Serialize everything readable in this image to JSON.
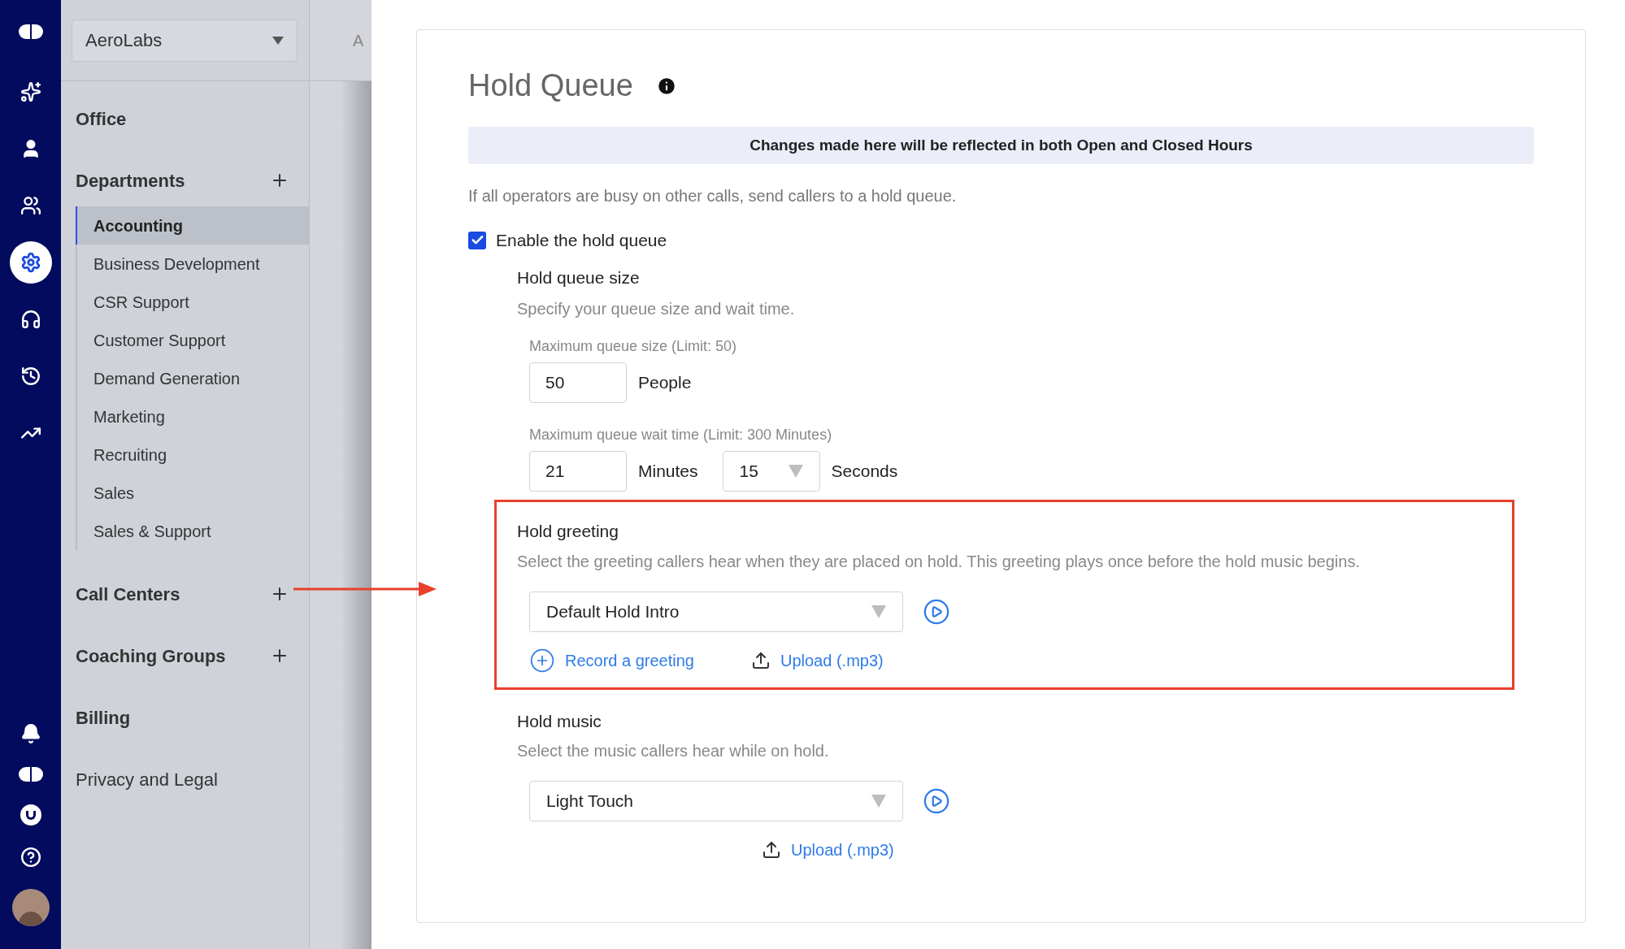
{
  "rail": {
    "top": [
      {
        "kind": "sparkle",
        "selected": false
      },
      {
        "kind": "person",
        "selected": false
      },
      {
        "kind": "team",
        "selected": false
      },
      {
        "kind": "gear",
        "selected": true
      },
      {
        "kind": "headset",
        "selected": false
      },
      {
        "kind": "history",
        "selected": false
      },
      {
        "kind": "trend",
        "selected": false
      }
    ],
    "bottom": [
      {
        "kind": "bell"
      },
      {
        "kind": "logo"
      },
      {
        "kind": "u"
      },
      {
        "kind": "help"
      },
      {
        "kind": "avatar"
      }
    ]
  },
  "sidebar": {
    "account": "AeroLabs",
    "header_fragment": "A",
    "sections": [
      {
        "label": "Office",
        "addable": false
      },
      {
        "label": "Departments",
        "addable": true,
        "children": [
          {
            "label": "Accounting",
            "selected": true
          },
          {
            "label": "Business Development",
            "selected": false
          },
          {
            "label": "CSR Support",
            "selected": false
          },
          {
            "label": "Customer Support",
            "selected": false
          },
          {
            "label": "Demand Generation",
            "selected": false
          },
          {
            "label": "Marketing",
            "selected": false
          },
          {
            "label": "Recruiting",
            "selected": false
          },
          {
            "label": "Sales",
            "selected": false
          },
          {
            "label": "Sales & Support",
            "selected": false
          }
        ]
      },
      {
        "label": "Call Centers",
        "addable": true
      },
      {
        "label": "Coaching Groups",
        "addable": true
      },
      {
        "label": "Billing",
        "addable": false
      },
      {
        "label": "Privacy and Legal",
        "addable": false
      }
    ]
  },
  "card": {
    "title": "Hold Queue",
    "banner": "Changes made here will be reflected in both Open and Closed Hours",
    "description": "If all operators are busy on other calls, send callers to a hold queue.",
    "enable": {
      "label": "Enable the hold queue",
      "checked": true
    },
    "queue_size": {
      "title": "Hold queue size",
      "subtitle": "Specify your queue size and wait time.",
      "max_size": {
        "label": "Maximum queue size (Limit: 50)",
        "value": "50",
        "unit": "People"
      },
      "wait": {
        "label": "Maximum queue wait time (Limit: 300 Minutes)",
        "minutes": "21",
        "minutes_unit": "Minutes",
        "seconds": "15",
        "seconds_unit": "Seconds"
      }
    },
    "sections": [
      {
        "title": "Hold greeting",
        "description": "Select the greeting callers hear when they are placed on hold. This greeting plays once before the hold music begins.",
        "value": "Default Hold Intro",
        "record": "Record a greeting",
        "upload": "Upload (.mp3)",
        "highlighted": true
      },
      {
        "title": "Hold music",
        "description": "Select the music callers hear while on hold.",
        "value": "Light Touch",
        "upload": "Upload (.mp3)",
        "highlighted": false
      }
    ]
  }
}
